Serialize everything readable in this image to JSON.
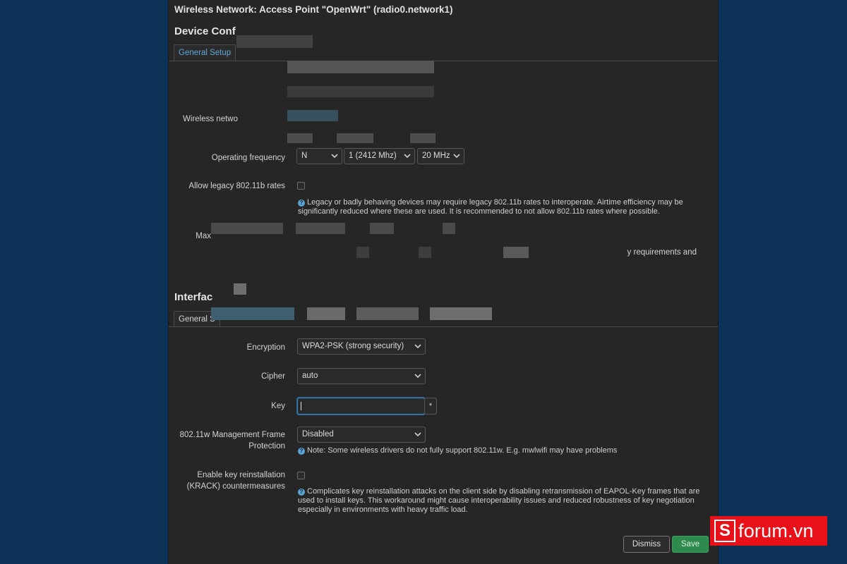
{
  "modal": {
    "title": "Wireless Network: Access Point \"OpenWrt\" (radio0.network1)"
  },
  "device": {
    "section_title": "Device Conf",
    "tab_general": "General Setup",
    "wireless_label": "Wireless netwo",
    "operating_frequency_label": "Operating frequency",
    "mode_value": "N",
    "channel_value": "1 (2412 Mhz)",
    "width_value": "20 MHz",
    "legacy_label": "Allow legacy 802.11b rates",
    "legacy_help": "Legacy or badly behaving devices may require legacy 802.11b rates to interoperate. Airtime efficiency may be significantly reduced where these are used. It is recommended to not allow 802.11b rates where possible.",
    "max_label": "Max",
    "partial_help": "y requirements and"
  },
  "interface": {
    "section_title": "Interfac",
    "tab_general": "General S",
    "encryption_label": "Encryption",
    "encryption_value": "WPA2-PSK (strong security)",
    "cipher_label": "Cipher",
    "cipher_value": "auto",
    "key_label": "Key",
    "key_reveal": "*",
    "mfp_label_1": "802.11w Management Frame",
    "mfp_label_2": "Protection",
    "mfp_value": "Disabled",
    "mfp_help": "Note: Some wireless drivers do not fully support 802.11w. E.g. mwlwifi may have problems",
    "krack_label_1": "Enable key reinstallation",
    "krack_label_2": "(KRACK) countermeasures",
    "krack_help": "Complicates key reinstallation attacks on the client side by disabling retransmission of EAPOL-Key frames that are used to install keys. This workaround might cause interoperability issues and reduced robustness of key negotiation especially in environments with heavy traffic load."
  },
  "footer": {
    "dismiss": "Dismiss",
    "save": "Save"
  },
  "watermark": {
    "mark": "S",
    "text": "forum.vn"
  },
  "colors": {
    "page_bg": "#0c3257",
    "modal_bg": "#262626",
    "accent": "#5fa7d9",
    "save": "#2f8a4e",
    "watermark": "#e8111a"
  }
}
